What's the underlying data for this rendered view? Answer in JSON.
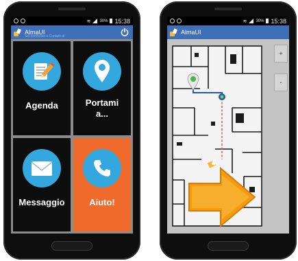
{
  "phones": [
    {
      "status": {
        "battery": "30%",
        "time": "15:38"
      },
      "appbar": {
        "title": "AlmaUI",
        "subtitle": "Sei connesso a Contatti di",
        "power_icon": "power-icon"
      },
      "tiles": [
        {
          "label": "Agenda",
          "icon": "notebook-pencil-icon"
        },
        {
          "label": "Portami a...",
          "icon": "location-pin-icon"
        },
        {
          "label": "Messaggio",
          "icon": "envelope-icon"
        },
        {
          "label": "Aiuto!",
          "icon": "phone-handset-icon"
        }
      ]
    },
    {
      "status": {
        "battery": "30%",
        "time": "15:38"
      },
      "appbar": {
        "title": "AlmaUI"
      },
      "map": {
        "zoom_in_label": "+",
        "zoom_out_label": "-",
        "route_color": "#2456b3",
        "dashed_route_color": "#e8574a",
        "arrow_color": "#f39c12",
        "destination_icon": "location-pin-icon",
        "direction_icon": "arrow-right-icon"
      }
    }
  ]
}
